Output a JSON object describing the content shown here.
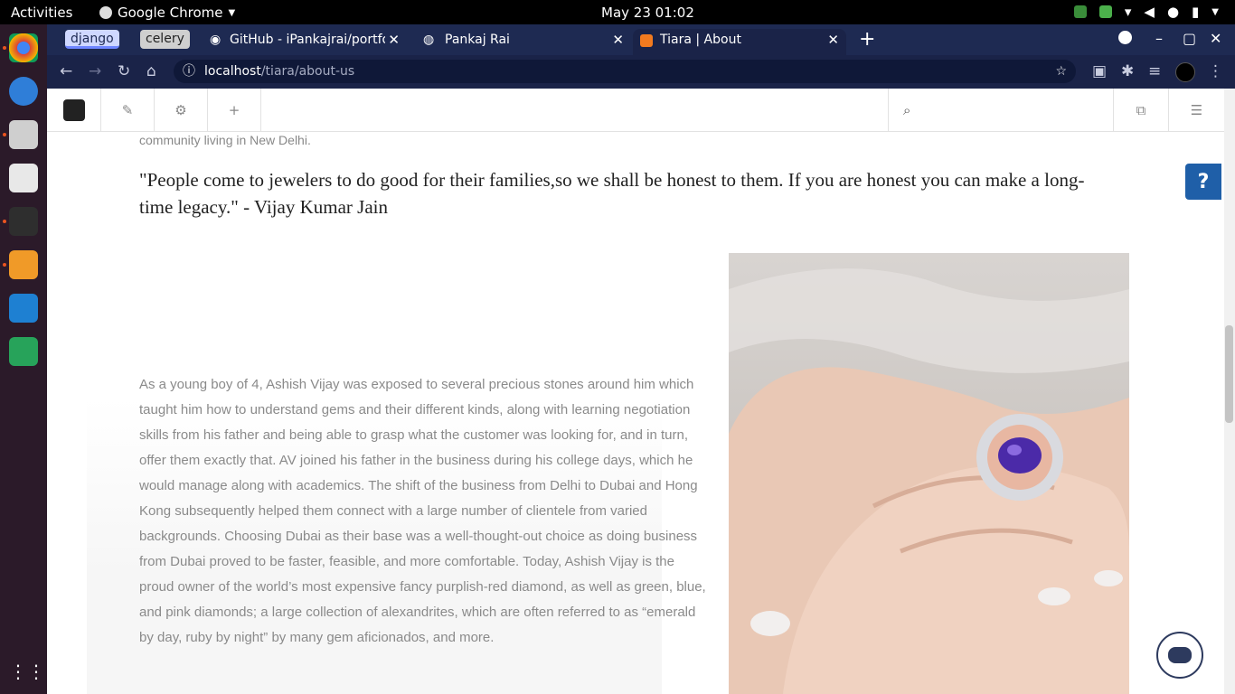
{
  "topbar": {
    "activities": "Activities",
    "app_name": "Google Chrome",
    "clock": "May 23  01:02"
  },
  "tabs": {
    "chip1": "django",
    "chip2": "celery",
    "tab1": "GitHub - iPankajrai/portfo",
    "tab2": "Pankaj Rai",
    "tab3": "Tiara | About"
  },
  "address": {
    "host": "localhost",
    "path": "/tiara/about-us"
  },
  "content": {
    "lead": "community living in New Delhi.",
    "quote": "\"People come to jewelers to do good for their families,so we shall be honest to them. If you are honest you can make a long-time legacy.\" - Vijay Kumar Jain",
    "body": "As a young boy of 4, Ashish Vijay was exposed to several precious stones around him which taught him how to understand gems and their different kinds, along with learning negotiation skills from his father and being able to grasp what the customer was looking for, and in turn, offer them exactly that. AV joined his father in the business during his college days, which he would manage along with academics. The shift of the business from Delhi to Dubai and Hong Kong subsequently helped them connect with a large number of clientele from varied backgrounds. Choosing Dubai as their base was a well-thought-out choice as doing business from Dubai proved to be faster, feasible, and more comfortable. Today, Ashish Vijay is the proud owner of the world’s most expensive fancy purplish-red diamond, as well as green, blue, and pink diamonds; a large collection of alexandrites, which are often referred to as “emerald by day, ruby by night” by many gem aficionados, and more."
  },
  "widgets": {
    "help": "?"
  }
}
